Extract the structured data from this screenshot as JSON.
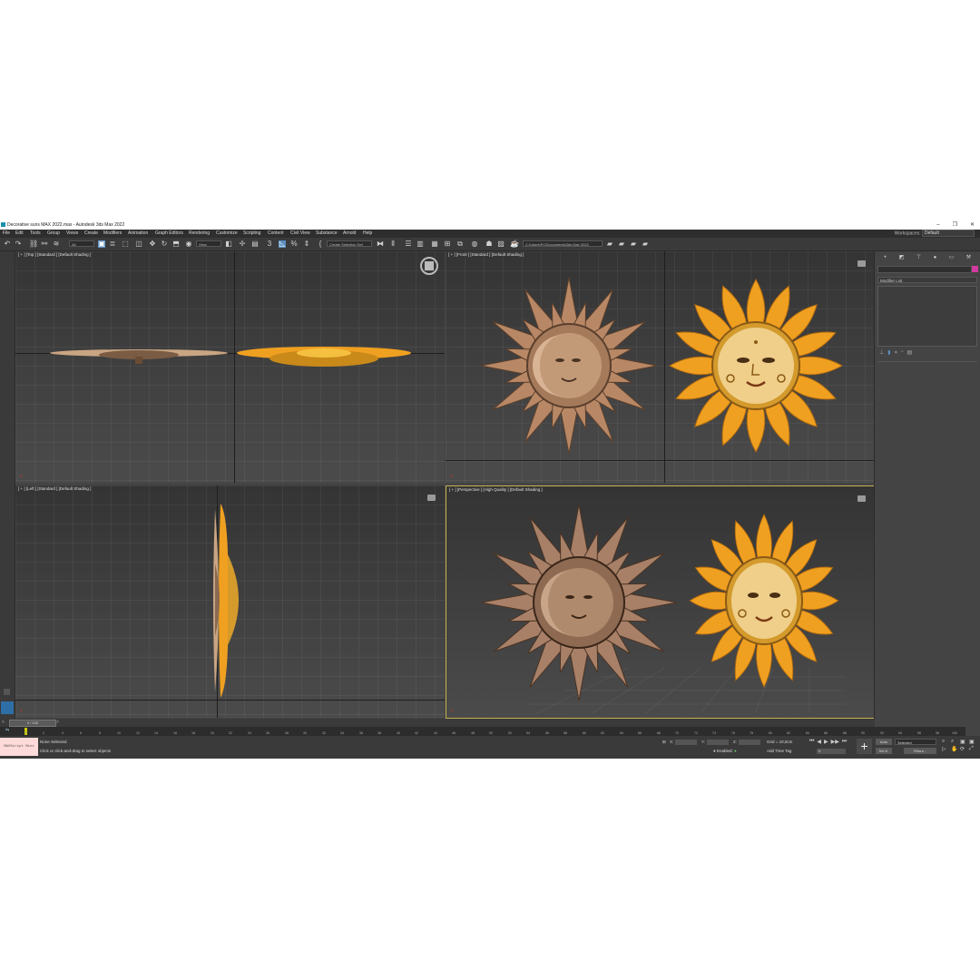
{
  "window": {
    "title": "Decorative suns MAX 2022.max - Autodesk 3ds Max 2022",
    "controls": [
      "–",
      "❐",
      "✕"
    ]
  },
  "menu": [
    "File",
    "Edit",
    "Tools",
    "Group",
    "Views",
    "Create",
    "Modifiers",
    "Animation",
    "Graph Editors",
    "Rendering",
    "Customize",
    "Scripting",
    "Content",
    "Civil View",
    "Substance",
    "Arnold",
    "Help"
  ],
  "workspace": {
    "label": "Workspaces:",
    "value": "Default"
  },
  "toolbar": {
    "filter": "All",
    "view": "View",
    "selection_set": "Create Selection Set",
    "project_path": "C:\\Users\\PC\\Documents\\3ds Max 2022"
  },
  "viewports": {
    "top": "[ + ] [Top ] [Standard ] [Default Shading ]",
    "front": "[ + ] [Front ] [Standard ] [Default Shading ]",
    "left": "[ + ] [Left ] [Standard ] [Default Shading ]",
    "perspective": "[ + ] [Perspective ] [High Quality ] [Default Shading ]"
  },
  "command_panel": {
    "modifier_list": "Modifier List"
  },
  "timeline": {
    "slider": "0 / 100",
    "ticks": [
      "0",
      "2",
      "4",
      "6",
      "8",
      "10",
      "12",
      "14",
      "16",
      "18",
      "20",
      "22",
      "24",
      "26",
      "28",
      "30",
      "32",
      "34",
      "36",
      "38",
      "40",
      "42",
      "44",
      "46",
      "48",
      "50",
      "52",
      "54",
      "56",
      "58",
      "60",
      "62",
      "64",
      "66",
      "68",
      "70",
      "72",
      "74",
      "76",
      "78",
      "80",
      "82",
      "84",
      "86",
      "88",
      "90",
      "92",
      "94",
      "96",
      "98",
      "100"
    ]
  },
  "status": {
    "maxscript": "MAXScript Mini",
    "selection": "None Selected",
    "prompt": "Click or click-and-drag to select objects",
    "x_label": "X:",
    "y_label": "Y:",
    "z_label": "Z:",
    "grid": "Grid = 10,0cm",
    "enabled": "Enabled:",
    "add_time_tag": "Add Time Tag",
    "auto": "Auto",
    "set_k": "Set K.",
    "selected": "Selected",
    "filters": "Filters...",
    "frame": "0"
  },
  "colors": {
    "sun_gold": "#f0a020",
    "sun_bronze": "#b88866",
    "accent": "#5a8fc2"
  }
}
